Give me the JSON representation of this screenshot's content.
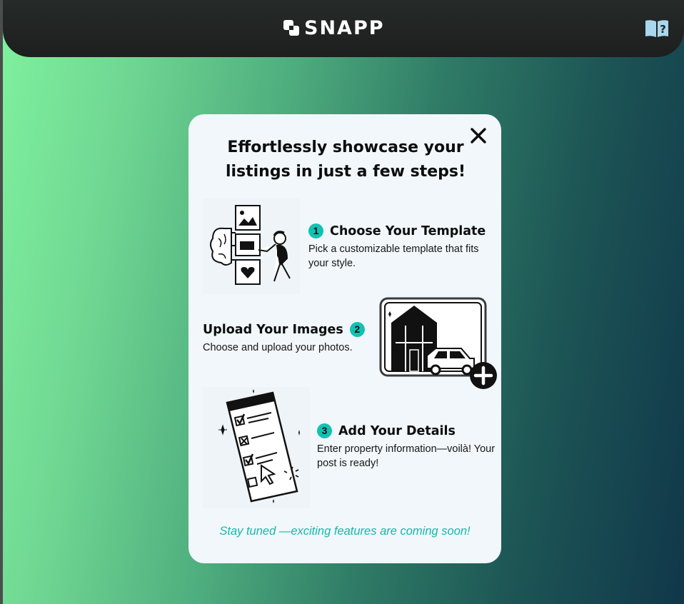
{
  "app": {
    "name": "SNAPP"
  },
  "header": {
    "logo_text": "SNAPP",
    "help_icon": "book-question-icon"
  },
  "modal": {
    "title": "Effortlessly showcase your listings in just a few steps!",
    "close_icon": "close-icon",
    "steps": [
      {
        "number": "1",
        "title": "Choose Your Template",
        "description": "Pick a customizable template that fits your style."
      },
      {
        "number": "2",
        "title": "Upload Your Images",
        "description": "Choose and upload your photos."
      },
      {
        "number": "3",
        "title": "Add Your Details",
        "description": "Enter property information—voilà! Your post is ready!"
      }
    ],
    "footer_note": "Stay tuned —exciting features are coming soon!"
  },
  "colors": {
    "accent": "#11c2b3",
    "header_bg": "#1f2321",
    "modal_bg": "#f1f7fb",
    "gradient_start": "#7ff29e",
    "gradient_end": "#10374a"
  }
}
